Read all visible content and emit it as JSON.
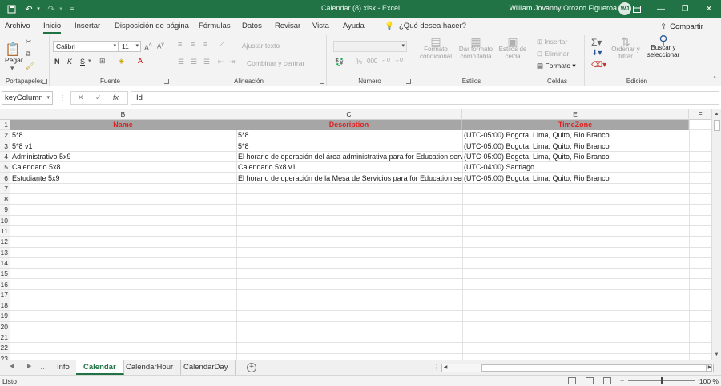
{
  "titlebar": {
    "doc_title": "Calendar (8).xlsx  -  Excel",
    "user_name": "William Jovanny Orozco Figueroa",
    "user_initials": "WJ"
  },
  "ribbon_tabs": [
    "Archivo",
    "Inicio",
    "Insertar",
    "Disposición de página",
    "Fórmulas",
    "Datos",
    "Revisar",
    "Vista",
    "Ayuda"
  ],
  "tell_me": "¿Qué desea hacer?",
  "share_label": "Compartir",
  "ribbon": {
    "clipboard": {
      "label": "Portapapeles",
      "paste": "Pegar"
    },
    "font": {
      "label": "Fuente",
      "font_name": "Calibri",
      "font_size": "11",
      "bold": "N",
      "italic": "K",
      "underline": "S"
    },
    "alignment": {
      "label": "Alineación",
      "wrap": "Ajustar texto",
      "merge": "Combinar y centrar"
    },
    "number": {
      "label": "Número",
      "format": ""
    },
    "styles": {
      "label": "Estilos",
      "conditional": "Formato condicional",
      "as_table": "Dar formato como tabla",
      "cell_styles": "Estilos de celda"
    },
    "cells": {
      "label": "Celdas",
      "insert": "Insertar",
      "delete": "Eliminar",
      "format": "Formato"
    },
    "editing": {
      "label": "Edición",
      "sort": "Ordenar y filtrar",
      "find": "Buscar y seleccionar"
    }
  },
  "formula_bar": {
    "name_box": "keyColumn",
    "formula": "Id"
  },
  "grid": {
    "columns": [
      "B",
      "C",
      "E",
      "F"
    ],
    "header_row": [
      "Name",
      "Description",
      "TimeZone"
    ],
    "rows": [
      [
        "5*8",
        "5*8",
        "(UTC-05:00) Bogota, Lima, Quito, Rio Branco"
      ],
      [
        "5*8 v1",
        "5*8",
        "(UTC-05:00) Bogota, Lima, Quito, Rio Branco"
      ],
      [
        "Administrativo 5x9",
        "El horario de operación del área administrativa para for Education services",
        "(UTC-05:00) Bogota, Lima, Quito, Rio Branco"
      ],
      [
        "Calendario 5x8",
        "Calendario 5x8 v1",
        "(UTC-04:00) Santiago"
      ],
      [
        "Estudiante 5x9",
        "El horario de operación de la Mesa de Servicios para for Education services",
        "(UTC-05:00) Bogota, Lima, Quito, Rio Branco"
      ]
    ],
    "row_numbers": [
      "1",
      "2",
      "3",
      "4",
      "5",
      "6",
      "7",
      "8",
      "9",
      "10",
      "11",
      "12",
      "13",
      "14",
      "15",
      "16",
      "17",
      "18",
      "19",
      "20",
      "21",
      "22",
      "23"
    ]
  },
  "sheets": {
    "tabs": [
      "Info",
      "Calendar",
      "CalendarHour",
      "CalendarDay"
    ],
    "active": "Calendar"
  },
  "status": {
    "ready": "Listo",
    "zoom": "100 %"
  },
  "colors": {
    "excel_green": "#217346",
    "header_fill": "#a6a6a6",
    "header_text": "#e02020"
  }
}
